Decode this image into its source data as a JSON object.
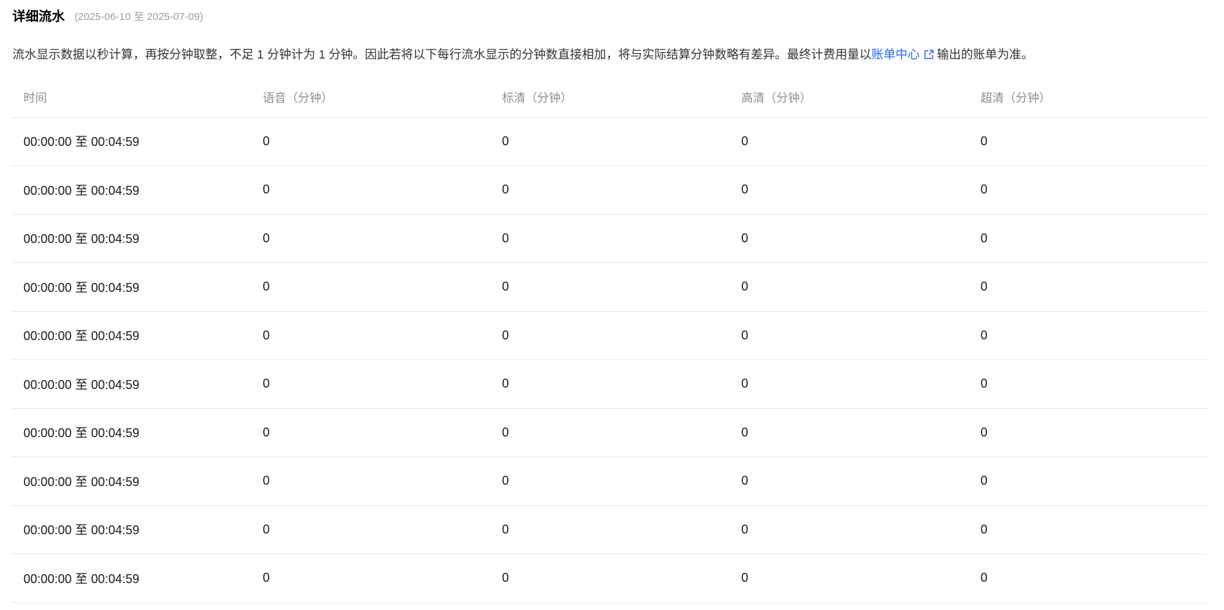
{
  "page": {
    "title": "详细流水",
    "date_range": "(2025-06-10 至 2025-07-09)"
  },
  "description": {
    "part1": "流水显示数据以秒计算，再按分钟取整，不足 1 分钟计为 1 分钟。因此若将以下每行流水显示的分钟数直接相加，将与实际结算分钟数略有差异。最终计费用量以",
    "link_label": "账单中心",
    "part2": "输出的账单为准。",
    "link_icon": "external-link-icon"
  },
  "colors": {
    "link_blue": "#2468f2",
    "header_text": "#8b8e95",
    "body_text": "#333333",
    "cell_text": "#1a1a1a",
    "divider": "#e6e7eb",
    "date_text": "#9c9c9c"
  },
  "table": {
    "columns": [
      "时间",
      "语音（分钟）",
      "标清（分钟）",
      "高清（分钟）",
      "超清（分钟）"
    ],
    "rows": [
      [
        "00:00:00 至 00:04:59",
        "0",
        "0",
        "0",
        "0"
      ],
      [
        "00:00:00 至 00:04:59",
        "0",
        "0",
        "0",
        "0"
      ],
      [
        "00:00:00 至 00:04:59",
        "0",
        "0",
        "0",
        "0"
      ],
      [
        "00:00:00 至 00:04:59",
        "0",
        "0",
        "0",
        "0"
      ],
      [
        "00:00:00 至 00:04:59",
        "0",
        "0",
        "0",
        "0"
      ],
      [
        "00:00:00 至 00:04:59",
        "0",
        "0",
        "0",
        "0"
      ],
      [
        "00:00:00 至 00:04:59",
        "0",
        "0",
        "0",
        "0"
      ],
      [
        "00:00:00 至 00:04:59",
        "0",
        "0",
        "0",
        "0"
      ],
      [
        "00:00:00 至 00:04:59",
        "0",
        "0",
        "0",
        "0"
      ],
      [
        "00:00:00 至 00:04:59",
        "0",
        "0",
        "0",
        "0"
      ]
    ]
  }
}
